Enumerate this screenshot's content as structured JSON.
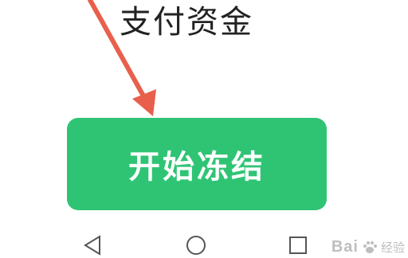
{
  "header": {
    "title": "支付资金"
  },
  "action": {
    "button_label": "开始冻结",
    "color": "#2fc474"
  },
  "annotation": {
    "icon": "arrow-icon",
    "color": "#e8604c"
  },
  "nav": {
    "back_icon": "triangle-back-icon",
    "home_icon": "circle-home-icon",
    "recents_icon": "square-recents-icon"
  },
  "watermark": {
    "brand": "Bai",
    "suffix": "经验"
  }
}
